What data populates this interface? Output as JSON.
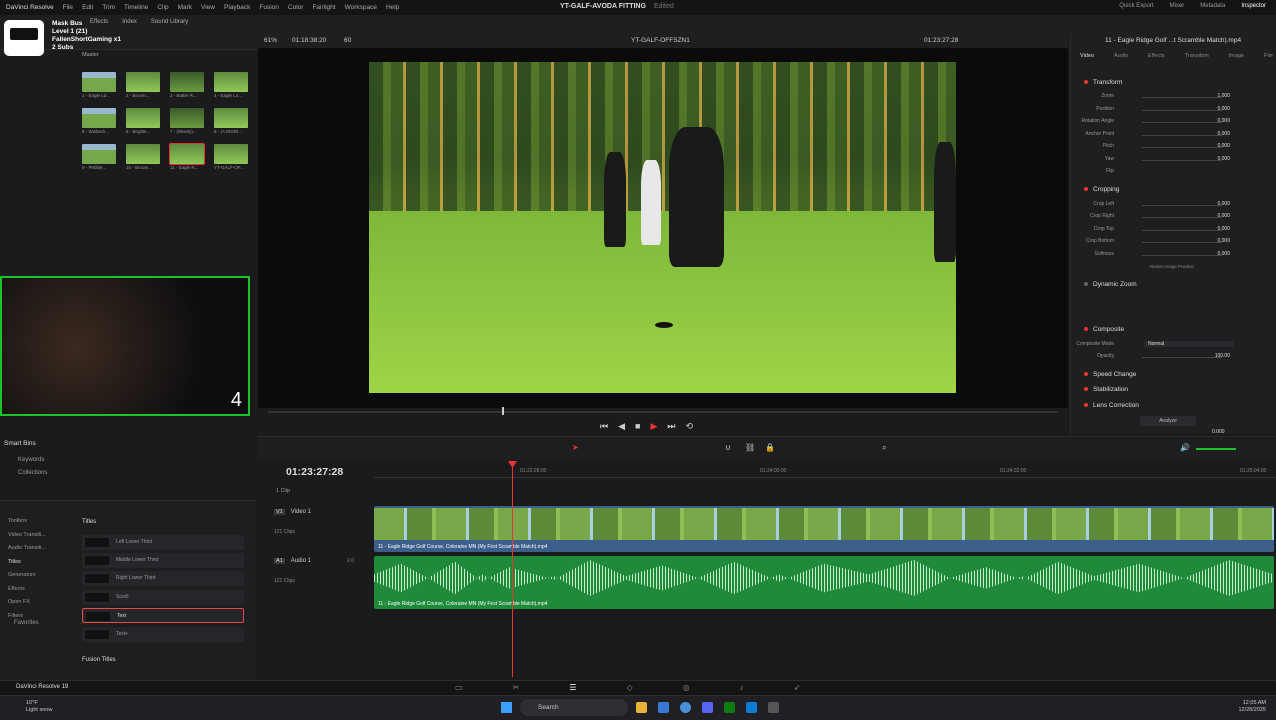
{
  "menu": {
    "app": "DaVinci Resolve",
    "items": [
      "File",
      "Edit",
      "Trim",
      "Timeline",
      "Clip",
      "Mark",
      "View",
      "Playback",
      "Fusion",
      "Color",
      "Fairlight",
      "Workspace",
      "Help"
    ]
  },
  "project": {
    "title": "YT-GALF-AVODA FITTING",
    "status": "Edited"
  },
  "top_right": {
    "quick_export": "Quick Export",
    "mixer": "Mixer",
    "metadata": "Metadata",
    "inspector": "Inspector"
  },
  "toolbar": {
    "master": "Mask Bus",
    "effects": "Effects",
    "index": "Index",
    "sound_library": "Sound Library"
  },
  "overlay": {
    "line1": "Level 1 (21)",
    "line2": "FallenShortGaming x1",
    "line3": "2 Subs"
  },
  "media_pool": {
    "label": "Master",
    "clips": [
      "1 - Eagle Ld...",
      "2 - Broom...",
      "3 - Batter R...",
      "4 - Eagle Lo...",
      "5 - Wisbeck...",
      "6 - Brigitte...",
      "7 - (Wisely)...",
      "8 - (A WORI...",
      "9 - Pebble...",
      "10 - Broom...",
      "11 - Eagle R...",
      "YT-GALF-OF..."
    ]
  },
  "webcam": {
    "counter": "4"
  },
  "smart_bins": {
    "title": "Smart Bins",
    "items": [
      "Keywords",
      "Collections"
    ]
  },
  "effects": {
    "left_items": [
      "Toolbox",
      "Video Transiti...",
      "Audio Transiti...",
      "Titles",
      "Generators",
      "Effects",
      "Open FX",
      "Filters"
    ],
    "titles_header": "Titles",
    "titles": [
      "Left Lower Third",
      "Middle Lower Third",
      "Right Lower Third",
      "Scroll",
      "Text",
      "Text+"
    ],
    "fusion_titles": "Fusion Titles",
    "favorites": "Favorites"
  },
  "viewer": {
    "zoom": "61%",
    "duration": "01:18:38:20",
    "fps": "60",
    "timeline_name": "YT-GALF-OFFSZN1",
    "timecode": "01:23:27:28"
  },
  "inspector": {
    "clip_title": "11 - Eagle Ridge Golf ...t Scramble Match).mp4",
    "tabs": [
      "Video",
      "Audio",
      "Effects",
      "Transition",
      "Image",
      "File"
    ],
    "transform": {
      "title": "Transform",
      "rows": [
        {
          "label": "Zoom",
          "value": "1.000"
        },
        {
          "label": "Position",
          "value": "0.000"
        },
        {
          "label": "Rotation Angle",
          "value": "0.000"
        },
        {
          "label": "Anchor Point",
          "value": "0.000"
        },
        {
          "label": "Pitch",
          "value": "0.000"
        },
        {
          "label": "Yaw",
          "value": "0.000"
        },
        {
          "label": "Flip",
          "value": ""
        }
      ]
    },
    "cropping": {
      "title": "Cropping",
      "rows": [
        {
          "label": "Crop Left",
          "value": "0.000"
        },
        {
          "label": "Crop Right",
          "value": "0.000"
        },
        {
          "label": "Crop Top",
          "value": "0.000"
        },
        {
          "label": "Crop Bottom",
          "value": "0.000"
        },
        {
          "label": "Softness",
          "value": "0.000"
        }
      ],
      "retain": "Retain Image Position"
    },
    "dynamic_zoom": "Dynamic Zoom",
    "composite": {
      "title": "Composite",
      "mode_label": "Composite Mode",
      "mode_value": "Normal",
      "opacity_label": "Opacity",
      "opacity_value": "100.00"
    },
    "speed_change": "Speed Change",
    "stabilization": "Stabilization",
    "lens_correction": "Lens Correction",
    "analyze": "Analyze",
    "distortion_value": "0.000"
  },
  "timeline": {
    "timecode": "01:23:27:28",
    "clip_count": "1 Clip",
    "ruler": [
      "01:22:28:00",
      "01:24:00:00",
      "01:24:32:00",
      "01:25:04:00"
    ],
    "video_track": {
      "code": "V1",
      "name": "Video 1",
      "clips": "121 Clips"
    },
    "audio_track": {
      "code": "A1",
      "name": "Audio 1",
      "level": "2.0",
      "clips": "121 Clips"
    },
    "clip_name": "11 - Eagle Ridge Golf Course, Coleraine MN (My First Scramble Match).mp4"
  },
  "status": {
    "app_version": "DaVinci Resolve 19"
  },
  "taskbar": {
    "weather_temp": "10°F",
    "weather_desc": "Light snow",
    "search": "Search",
    "time": "12:05 AM",
    "date": "12/28/2025"
  }
}
